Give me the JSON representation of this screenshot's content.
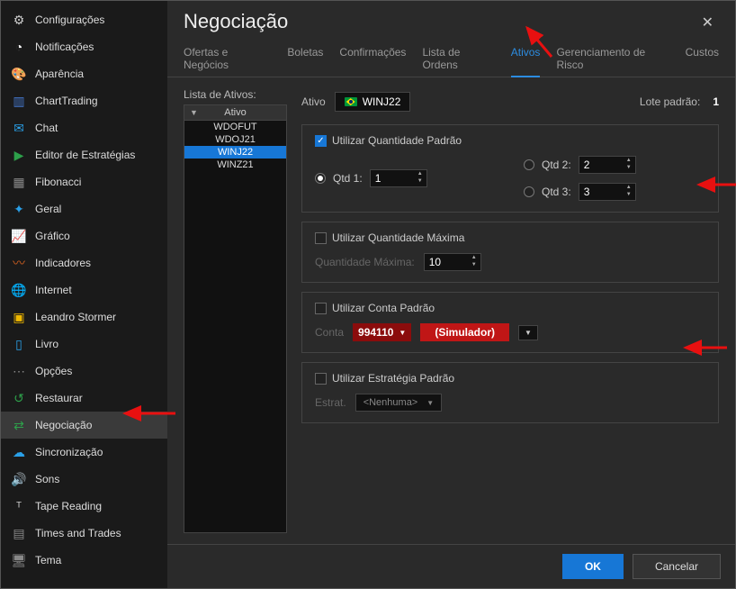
{
  "sidebar": {
    "items": [
      {
        "label": "Configurações",
        "icon": "gear-icon",
        "color": "#ccc"
      },
      {
        "label": "Notificações",
        "icon": "bell-icon",
        "color": "#fff"
      },
      {
        "label": "Aparência",
        "icon": "palette-icon",
        "color": "#e04aa0"
      },
      {
        "label": "ChartTrading",
        "icon": "chart-trade-icon",
        "color": "#47c"
      },
      {
        "label": "Chat",
        "icon": "chat-icon",
        "color": "#2aa0e8"
      },
      {
        "label": "Editor de Estratégias",
        "icon": "strategy-editor-icon",
        "color": "#2da04a"
      },
      {
        "label": "Fibonacci",
        "icon": "fibonacci-icon",
        "color": "#888"
      },
      {
        "label": "Geral",
        "icon": "general-icon",
        "color": "#2aa0e8"
      },
      {
        "label": "Gráfico",
        "icon": "graph-icon",
        "color": "#d06020"
      },
      {
        "label": "Indicadores",
        "icon": "indicators-icon",
        "color": "#d06020"
      },
      {
        "label": "Internet",
        "icon": "internet-icon",
        "color": "#2aa0e8"
      },
      {
        "label": "Leandro Stormer",
        "icon": "stormer-icon",
        "color": "#f0b800"
      },
      {
        "label": "Livro",
        "icon": "book-icon",
        "color": "#2aa0e8"
      },
      {
        "label": "Opções",
        "icon": "options-icon",
        "color": "#888"
      },
      {
        "label": "Restaurar",
        "icon": "restore-icon",
        "color": "#2da04a"
      },
      {
        "label": "Negociação",
        "icon": "negotiation-icon",
        "color": "#2da04a",
        "selected": true
      },
      {
        "label": "Sincronização",
        "icon": "sync-icon",
        "color": "#2aa0e8"
      },
      {
        "label": "Sons",
        "icon": "sound-icon",
        "color": "#ccc"
      },
      {
        "label": "Tape Reading",
        "icon": "tape-icon",
        "color": "#ccc"
      },
      {
        "label": "Times and Trades",
        "icon": "times-trades-icon",
        "color": "#888"
      },
      {
        "label": "Tema",
        "icon": "theme-icon",
        "color": "#888"
      }
    ]
  },
  "header": {
    "title": "Negociação"
  },
  "tabs": [
    {
      "label": "Ofertas e Negócios"
    },
    {
      "label": "Boletas"
    },
    {
      "label": "Confirmações"
    },
    {
      "label": "Lista de Ordens"
    },
    {
      "label": "Ativos",
      "active": true
    },
    {
      "label": "Gerenciamento de Risco"
    },
    {
      "label": "Custos"
    }
  ],
  "assets": {
    "listLabel": "Lista de Ativos:",
    "columnHeader": "Ativo",
    "rows": [
      {
        "label": "WDOFUT"
      },
      {
        "label": "WDOJ21"
      },
      {
        "label": "WINJ22",
        "selected": true
      },
      {
        "label": "WINZ21"
      }
    ]
  },
  "form": {
    "ativoLabel": "Ativo",
    "ativoValue": "WINJ22",
    "loteLabel": "Lote padrão:",
    "loteValue": "1",
    "useQtyLabel": "Utilizar Quantidade Padrão",
    "qtd1Label": "Qtd 1:",
    "qtd1Value": "1",
    "qtd2Label": "Qtd 2:",
    "qtd2Value": "2",
    "qtd3Label": "Qtd 3:",
    "qtd3Value": "3",
    "useMaxLabel": "Utilizar Quantidade Máxima",
    "maxLabel": "Quantidade Máxima:",
    "maxValue": "10",
    "useAccountLabel": "Utilizar Conta Padrão",
    "accountLabel": "Conta",
    "accountValue": "994110",
    "accountType": "(Simulador)",
    "useStratLabel": "Utilizar Estratégia Padrão",
    "stratLabel": "Estrat.",
    "stratValue": "<Nenhuma>"
  },
  "footer": {
    "ok": "OK",
    "cancel": "Cancelar"
  }
}
